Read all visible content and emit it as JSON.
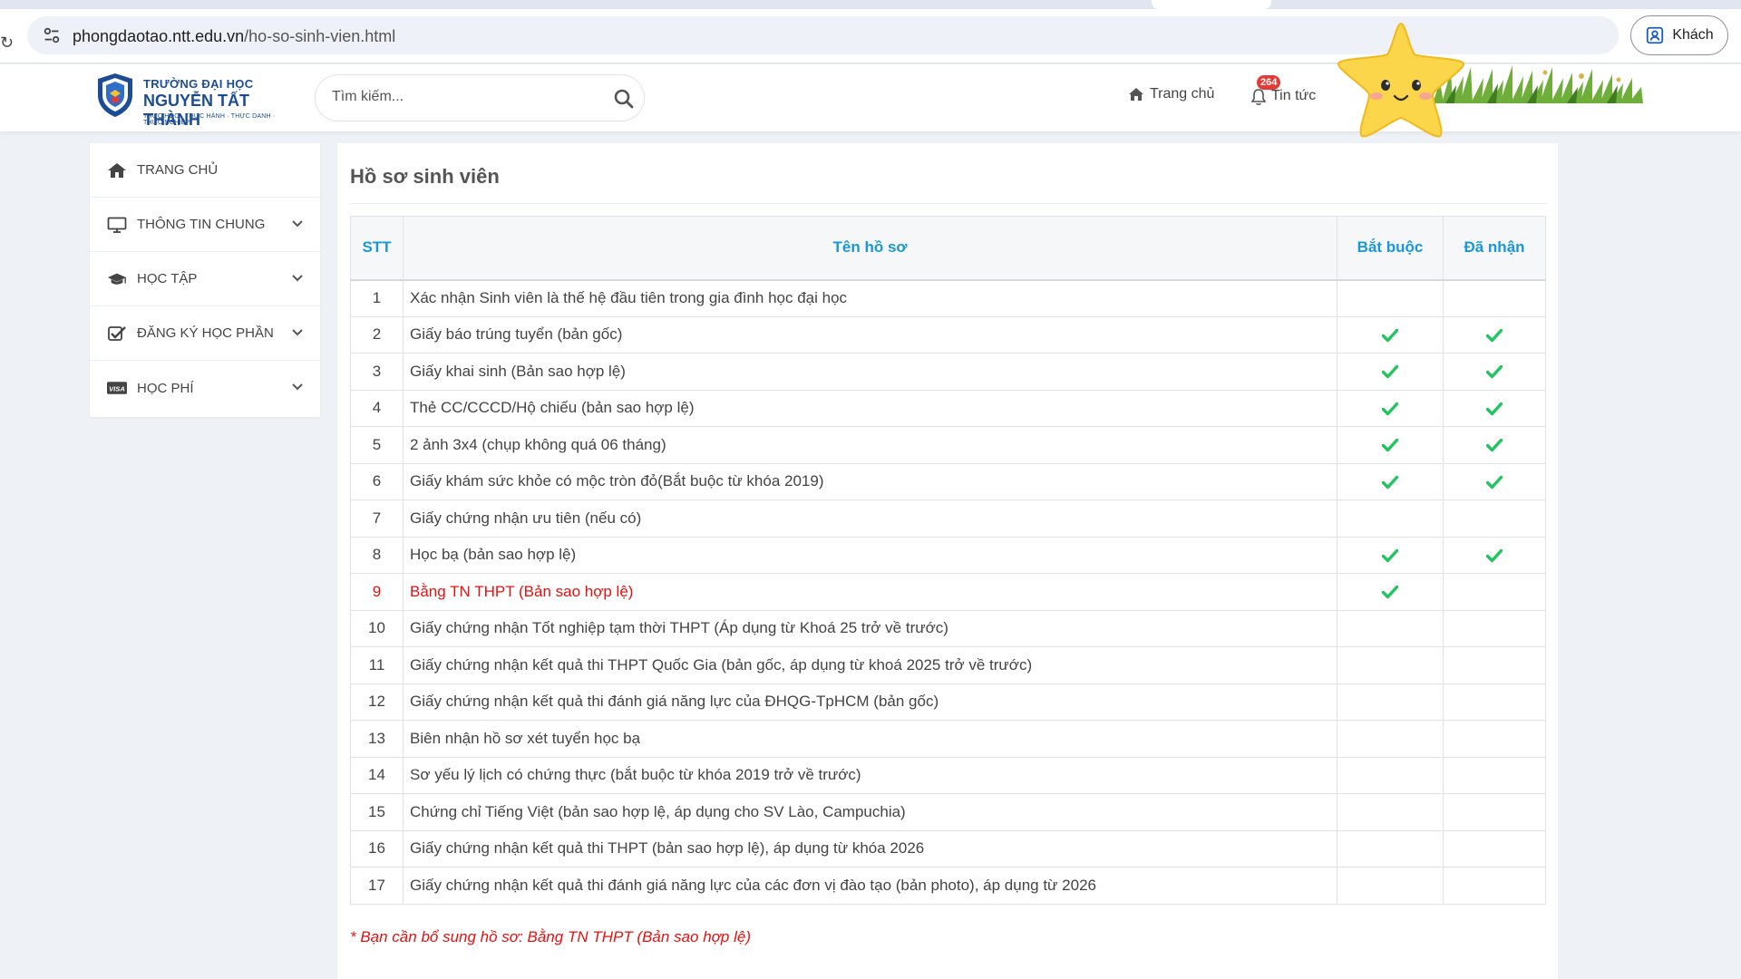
{
  "browser": {
    "url_host": "phongdaotao.ntt.edu.vn",
    "url_path": "/ho-so-sinh-vien.html",
    "profile_label": "Khách"
  },
  "header": {
    "logo": {
      "line1": "TRƯỜNG ĐẠI HỌC",
      "line2": "NGUYỄN TẤT THÀNH",
      "line3": "THỰC HỌC · THỰC HÀNH · THỰC DANH · THỰC NGHIỆP"
    },
    "search_placeholder": "Tìm kiếm...",
    "nav_home": "Trang chủ",
    "nav_news": "Tin tức",
    "news_badge": "264"
  },
  "sidebar": {
    "items": [
      {
        "label": "TRANG CHỦ",
        "icon": "home-icon",
        "has_chevron": false
      },
      {
        "label": "THÔNG TIN CHUNG",
        "icon": "monitor-icon",
        "has_chevron": true
      },
      {
        "label": "HỌC TẬP",
        "icon": "graduation-cap-icon",
        "has_chevron": true
      },
      {
        "label": "ĐĂNG KÝ HỌC PHẦN",
        "icon": "checkbox-icon",
        "has_chevron": true
      },
      {
        "label": "HỌC PHÍ",
        "icon": "visa-card-icon",
        "has_chevron": true
      }
    ]
  },
  "main": {
    "title": "Hồ sơ sinh viên",
    "columns": {
      "stt": "STT",
      "name": "Tên hồ sơ",
      "required": "Bắt buộc",
      "received": "Đã nhận"
    },
    "rows": [
      {
        "stt": "1",
        "name": "Xác nhận Sinh viên là thế hệ đầu tiên trong gia đình học đại học",
        "required": false,
        "received": false,
        "missing": false
      },
      {
        "stt": "2",
        "name": "Giấy báo trúng tuyển (bản gốc)",
        "required": true,
        "received": true,
        "missing": false
      },
      {
        "stt": "3",
        "name": "Giấy khai sinh (Bản sao hợp lệ)",
        "required": true,
        "received": true,
        "missing": false
      },
      {
        "stt": "4",
        "name": "Thẻ CC/CCCD/Hộ chiếu (bản sao hợp lệ)",
        "required": true,
        "received": true,
        "missing": false
      },
      {
        "stt": "5",
        "name": "2 ảnh 3x4 (chụp không quá 06 tháng)",
        "required": true,
        "received": true,
        "missing": false
      },
      {
        "stt": "6",
        "name": "Giấy khám sức khỏe có mộc tròn đỏ(Bắt buộc từ khóa 2019)",
        "required": true,
        "received": true,
        "missing": false
      },
      {
        "stt": "7",
        "name": "Giấy chứng nhận ưu tiên (nếu có)",
        "required": false,
        "received": false,
        "missing": false
      },
      {
        "stt": "8",
        "name": "Học bạ (bản sao hợp lệ)",
        "required": true,
        "received": true,
        "missing": false
      },
      {
        "stt": "9",
        "name": "Bằng TN THPT (Bản sao hợp lệ)",
        "required": true,
        "received": false,
        "missing": true
      },
      {
        "stt": "10",
        "name": "Giấy chứng nhận Tốt nghiệp tạm thời THPT (Áp dụng từ Khoá 25 trở về trước)",
        "required": false,
        "received": false,
        "missing": false
      },
      {
        "stt": "11",
        "name": "Giấy chứng nhận kết quả thi THPT Quốc Gia (bản gốc, áp dụng từ khoá 2025 trở về trước)",
        "required": false,
        "received": false,
        "missing": false
      },
      {
        "stt": "12",
        "name": "Giấy chứng nhận kết quả thi đánh giá năng lực của ĐHQG-TpHCM (bản gốc)",
        "required": false,
        "received": false,
        "missing": false
      },
      {
        "stt": "13",
        "name": "Biên nhận hồ sơ xét tuyển học bạ",
        "required": false,
        "received": false,
        "missing": false
      },
      {
        "stt": "14",
        "name": "Sơ yếu lý lịch có chứng thực (bắt buộc từ khóa 2019 trở về trước)",
        "required": false,
        "received": false,
        "missing": false
      },
      {
        "stt": "15",
        "name": "Chứng chỉ Tiếng Việt (bản sao hợp lệ, áp dụng cho SV Lào, Campuchia)",
        "required": false,
        "received": false,
        "missing": false
      },
      {
        "stt": "16",
        "name": "Giấy chứng nhận kết quả thi THPT (bản sao hợp lệ), áp dụng từ khóa 2026",
        "required": false,
        "received": false,
        "missing": false
      },
      {
        "stt": "17",
        "name": "Giấy chứng nhận kết quả thi đánh giá năng lực của các đơn vị đào tạo (bản photo), áp dụng từ 2026",
        "required": false,
        "received": false,
        "missing": false
      }
    ],
    "note": "* Bạn cần bổ sung hồ sơ: Bằng TN THPT (Bản sao hợp lệ)"
  },
  "colors": {
    "accent": "#1a97d8",
    "check": "#22c55e",
    "warning": "#e5110f",
    "brand": "#1c4d94"
  }
}
